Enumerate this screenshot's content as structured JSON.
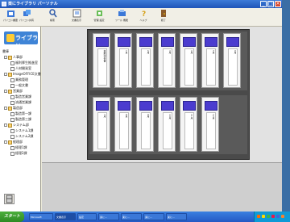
{
  "window": {
    "title": "楽にライブラリ パーソナル"
  },
  "toolbar": [
    {
      "label": "パソコン書庫",
      "icon": "library-icon"
    },
    {
      "label": "パソコン共有",
      "icon": "share-icon"
    },
    {
      "label": "検索",
      "icon": "search-icon"
    },
    {
      "label": "文書表示",
      "icon": "document-icon"
    },
    {
      "label": "管理 設定",
      "icon": "settings-icon"
    },
    {
      "label": "ツール 機能",
      "icon": "tools-icon"
    },
    {
      "label": "ヘルプ",
      "icon": "help-icon"
    },
    {
      "label": "終了",
      "icon": "exit-icon"
    }
  ],
  "sidebar": {
    "banner": "ライブラリ",
    "tree": [
      {
        "label": "書庫",
        "level": 0,
        "type": "root"
      },
      {
        "label": "人事部",
        "level": 1,
        "type": "folder"
      },
      {
        "label": "福利厚生推進室",
        "level": 2,
        "type": "doc"
      },
      {
        "label": "人材開発室",
        "level": 2,
        "type": "doc"
      },
      {
        "label": "ImageOFFICE文書",
        "level": 1,
        "type": "folder"
      },
      {
        "label": "業務管理",
        "level": 2,
        "type": "doc"
      },
      {
        "label": "一般文書",
        "level": 2,
        "type": "doc"
      },
      {
        "label": "営業部",
        "level": 1,
        "type": "folder"
      },
      {
        "label": "製造営業課",
        "level": 2,
        "type": "doc"
      },
      {
        "label": "流通営業課",
        "level": 2,
        "type": "doc"
      },
      {
        "label": "製造部",
        "level": 1,
        "type": "folder"
      },
      {
        "label": "製造第一課",
        "level": 2,
        "type": "doc"
      },
      {
        "label": "製造第三課",
        "level": 2,
        "type": "doc"
      },
      {
        "label": "システム部",
        "level": 1,
        "type": "folder"
      },
      {
        "label": "システム1課",
        "level": 2,
        "type": "doc"
      },
      {
        "label": "システム2課",
        "level": 2,
        "type": "doc"
      },
      {
        "label": "経理部",
        "level": 1,
        "type": "folder"
      },
      {
        "label": "経理1課",
        "level": 2,
        "type": "doc"
      },
      {
        "label": "経理2課",
        "level": 2,
        "type": "doc"
      }
    ]
  },
  "cabinet": {
    "top_shelf": [
      "業務報告書",
      "1月",
      "2月",
      "3月",
      "4月",
      "5月",
      "6月"
    ],
    "bottom_shelf": [
      "7月",
      "8月",
      "9月",
      "10月",
      "11月",
      "12月"
    ]
  },
  "taskbar": {
    "start": "スタート",
    "tasks": [
      "Microsoft",
      "文書表示",
      "設定",
      "楽に...",
      "楽に...",
      "楽に...",
      "楽に..."
    ]
  }
}
